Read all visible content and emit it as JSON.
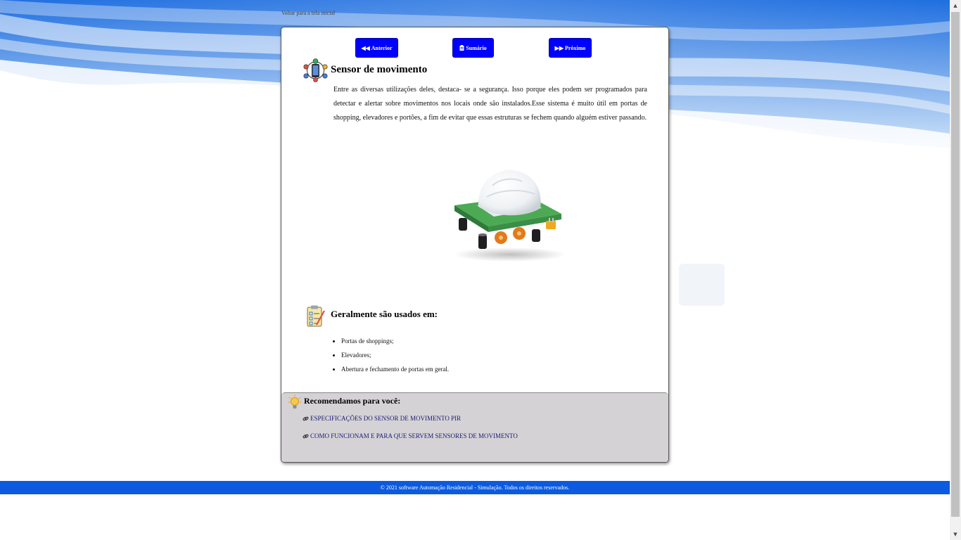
{
  "header": {
    "back_link": "Voltar para a tela inicial"
  },
  "nav": {
    "prev_label": "Anterior",
    "prev_icon": "backward-icon",
    "summary_label": "Sumário",
    "summary_icon": "clipboard-icon",
    "next_label": "Próximo",
    "next_icon": "forward-icon",
    "button_color": "#0000ff"
  },
  "content": {
    "title": "Sensor de movimento",
    "paragraph": "Entre as diversas utilizações deles, destaca- se a segurança. Isso porque eles podem ser programados para detectar e alertar sobre movimentos nos locais onde são instalados.Esse sistema é muito útil em portas de shopping, elevadores e portões, a fim de evitar que essas estruturas se fechem quando alguém estiver passando.",
    "image_name": "pir-motion-sensor-image",
    "usage_title": "Geralmente são usados em:",
    "usage_items": [
      "Portas de shoppings;",
      "Elevadores;",
      "Abertura e fechamento de portas em geral."
    ]
  },
  "recommendations": {
    "title": "Recomendamos para você:",
    "links": [
      "ESPECIFICAÇÕES DO SENSOR DE MOVIMENTO PIR",
      "COMO FUNCIONAM E PARA QUE SERVEM SENSORES DE MOVIMENTO"
    ],
    "background_color": "#d4d2d4"
  },
  "footer": {
    "text": "© 2021 software Automação Residencial - Simulação. Todos os direitos reservados.",
    "color": "#0b5ae0"
  }
}
